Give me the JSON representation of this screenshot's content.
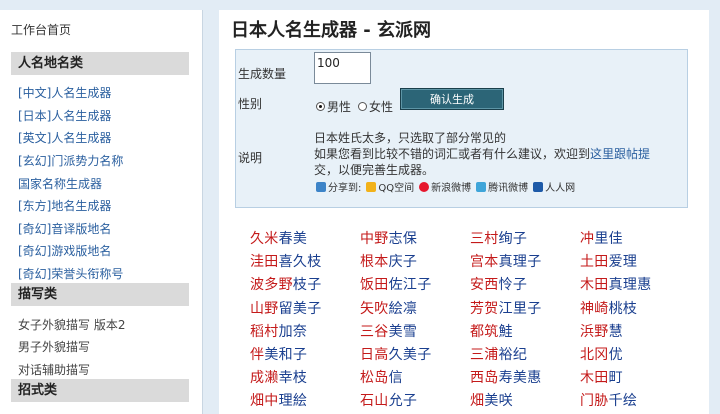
{
  "sidebar": {
    "home": "工作台首页",
    "sections": [
      {
        "title": "人名地名类",
        "items": [
          "[中文]人名生成器",
          "[日本]人名生成器",
          "[英文]人名生成器",
          "[玄幻]门派势力名称",
          "国家名称生成器",
          "[东方]地名生成器",
          "[奇幻]音译版地名",
          "[奇幻]游戏版地名",
          "[奇幻]荣誉头衔称号"
        ]
      },
      {
        "title": "描写类",
        "items": [
          "女子外貌描写 版本2",
          "男子外貌描写",
          "对话辅助描写"
        ]
      },
      {
        "title": "招式类",
        "items": []
      }
    ]
  },
  "main": {
    "title": "日本人名生成器 - 玄派网",
    "form": {
      "qty_label": "生成数量",
      "qty_value": "100",
      "gender_label": "性别",
      "male": "男性",
      "female": "女性",
      "submit": "确认生成",
      "note_label": "说明",
      "note_line1": "日本姓氏太多，只选取了部分常见的",
      "note_line2a": "如果您看到比较不错的词汇或者有什么建议，欢迎到",
      "note_link": "这里跟帖提",
      "note_line3": "交，以便完善生成器。",
      "share": {
        "label": "分享到:",
        "items": [
          "QQ空间",
          "新浪微博",
          "腾讯微博",
          "人人网"
        ]
      }
    },
    "names": [
      {
        "s": "久米",
        "g": "春美"
      },
      {
        "s": "中野",
        "g": "志保"
      },
      {
        "s": "三村",
        "g": "绚子"
      },
      {
        "s": "冲",
        "g": "里佳"
      },
      {
        "s": "洼田",
        "g": "喜久枝"
      },
      {
        "s": "根本",
        "g": "庆子"
      },
      {
        "s": "宫本",
        "g": "真理子"
      },
      {
        "s": "土田",
        "g": "爱理"
      },
      {
        "s": "波多野",
        "g": "枝子"
      },
      {
        "s": "饭田",
        "g": "佐江子"
      },
      {
        "s": "安西",
        "g": "怜子"
      },
      {
        "s": "木田",
        "g": "真理惠"
      },
      {
        "s": "山野",
        "g": "留美子"
      },
      {
        "s": "矢吹",
        "g": "絵凛"
      },
      {
        "s": "芳贺",
        "g": "江里子"
      },
      {
        "s": "神崎",
        "g": "桃枝"
      },
      {
        "s": "稻村",
        "g": "加奈"
      },
      {
        "s": "三谷",
        "g": "美雪"
      },
      {
        "s": "都筑",
        "g": "鮭"
      },
      {
        "s": "浜野",
        "g": "慧"
      },
      {
        "s": "伴",
        "g": "美和子"
      },
      {
        "s": "日高",
        "g": "久美子"
      },
      {
        "s": "三浦",
        "g": "裕纪"
      },
      {
        "s": "北冈",
        "g": "优"
      },
      {
        "s": "成濑",
        "g": "幸枝"
      },
      {
        "s": "松岛",
        "g": "信"
      },
      {
        "s": "西岛",
        "g": "寿美惠"
      },
      {
        "s": "木田",
        "g": "町"
      },
      {
        "s": "畑中",
        "g": "理絵"
      },
      {
        "s": "石山",
        "g": "允子"
      },
      {
        "s": "畑",
        "g": "美咲"
      },
      {
        "s": "门胁",
        "g": "千绘"
      }
    ]
  },
  "colors": {
    "page_bg": "#e2ecf5",
    "surname": "#c41a1a",
    "given": "#1a3f8f",
    "link": "#2a5f9f",
    "button": "#2c6577"
  }
}
